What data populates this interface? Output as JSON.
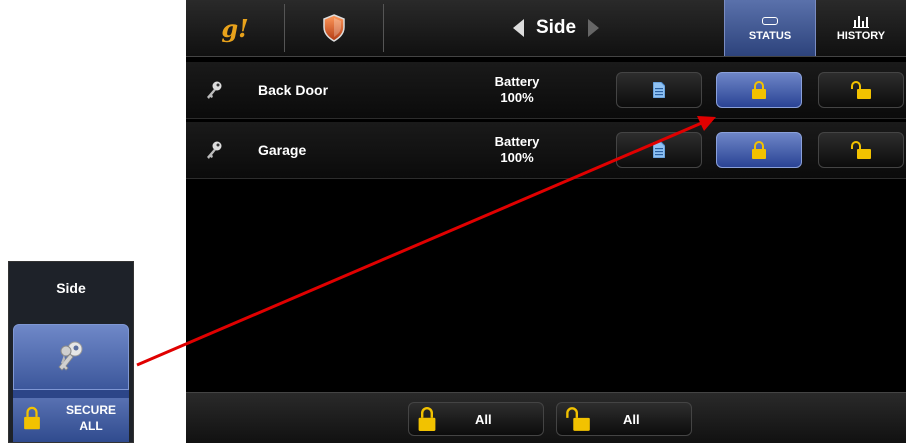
{
  "header": {
    "logo_text": "g!",
    "title": "Side",
    "tabs": [
      {
        "label": "STATUS",
        "icon": "status-icon",
        "active": true
      },
      {
        "label": "HISTORY",
        "icon": "history-chart-icon",
        "active": false
      }
    ]
  },
  "locks": [
    {
      "name": "Back Door",
      "battery_label": "Battery",
      "battery_value": "100%",
      "state": "locked"
    },
    {
      "name": "Garage",
      "battery_label": "Battery",
      "battery_value": "100%",
      "state": "locked"
    }
  ],
  "footer": {
    "lock_all_label": "All",
    "unlock_all_label": "All"
  },
  "widget": {
    "title": "Side",
    "secure_line1": "SECURE",
    "secure_line2": "ALL"
  },
  "colors": {
    "accent_blue": "#3f5aa6",
    "lock_gold": "#f2c200",
    "logo_orange": "#e8a21b",
    "arrow_red": "#e00000"
  }
}
